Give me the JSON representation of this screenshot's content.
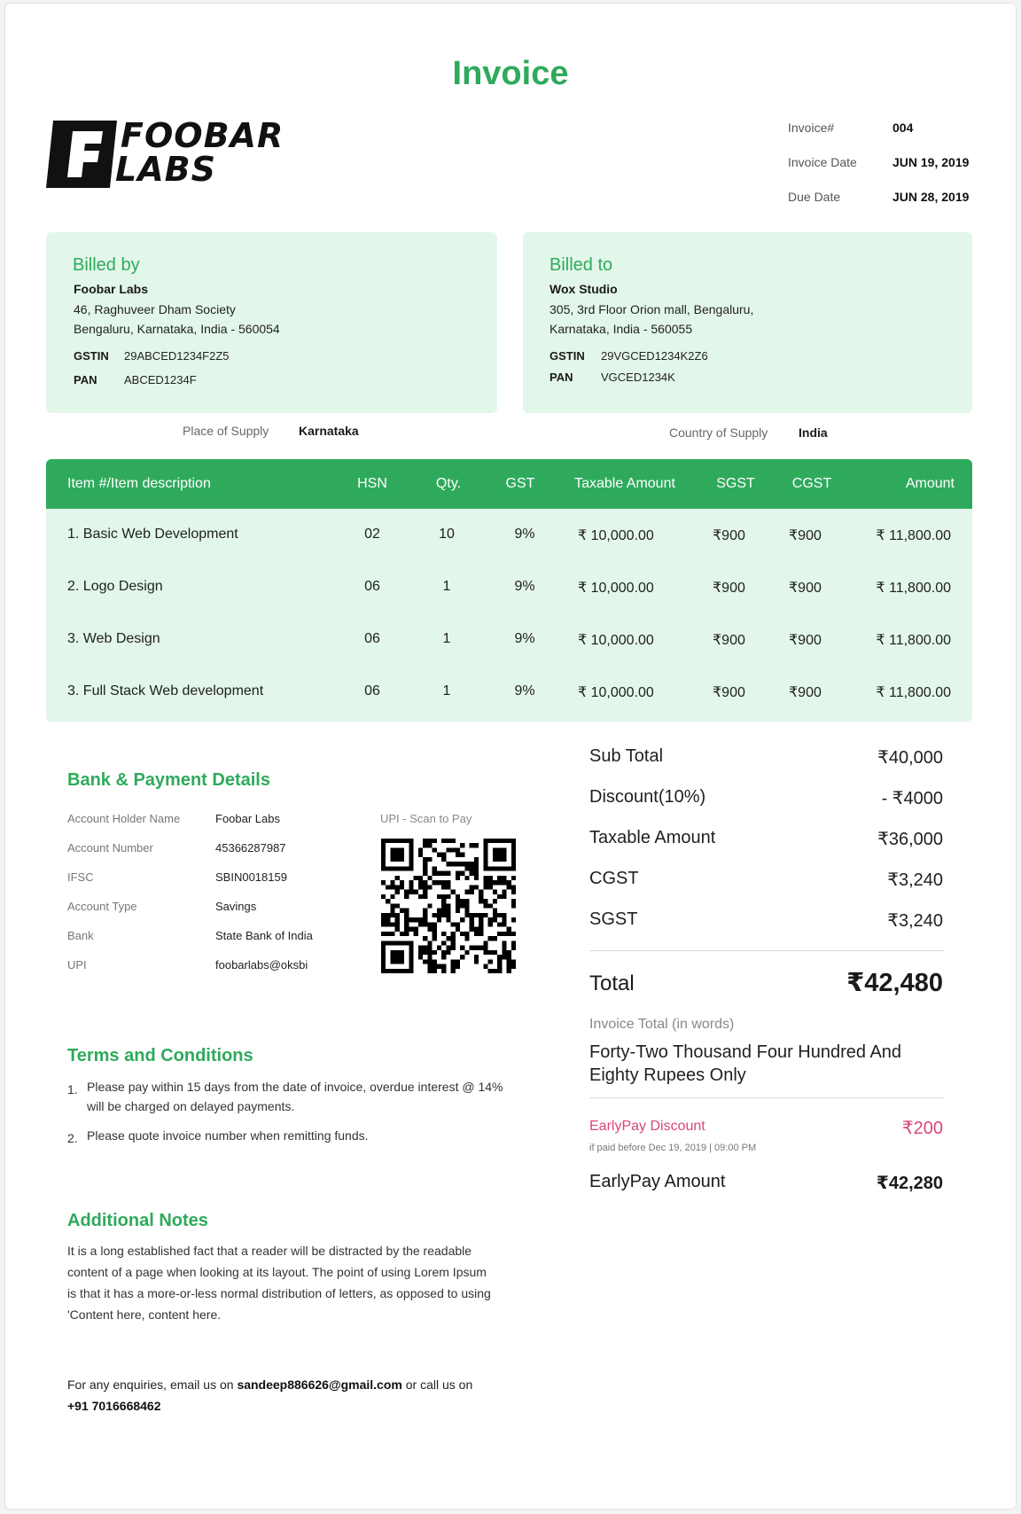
{
  "title": "Invoice",
  "logo": {
    "line1": "FOOBAR",
    "line2": "LABS",
    "mark": "F"
  },
  "meta": {
    "invoice_no_label": "Invoice#",
    "invoice_no": "004",
    "invoice_date_label": "Invoice Date",
    "invoice_date": "JUN 19, 2019",
    "due_date_label": "Due Date",
    "due_date": "JUN 28, 2019"
  },
  "billed_by": {
    "title": "Billed by",
    "name": "Foobar Labs",
    "address1": "46, Raghuveer Dham Society",
    "address2": "Bengaluru, Karnataka, India - 560054",
    "gstin_label": "GSTIN",
    "gstin": "29ABCED1234F2Z5",
    "pan_label": "PAN",
    "pan": "ABCED1234F"
  },
  "billed_to": {
    "title": "Billed to",
    "name": "Wox Studio",
    "address1": "305, 3rd Floor Orion mall, Bengaluru,",
    "address2": "Karnataka, India - 560055",
    "gstin_label": "GSTIN",
    "gstin": "29VGCED1234K2Z6",
    "pan_label": "PAN",
    "pan": "VGCED1234K"
  },
  "supply": {
    "place_label": "Place of Supply",
    "place": "Karnataka",
    "country_label": "Country of Supply",
    "country": "India"
  },
  "table": {
    "headers": [
      "Item #/Item description",
      "HSN",
      "Qty.",
      "GST",
      "Taxable Amount",
      "SGST",
      "CGST",
      "Amount"
    ],
    "rows": [
      {
        "item": "1.  Basic Web Development",
        "hsn": "02",
        "qty": "10",
        "gst": "9%",
        "taxable": "₹ 10,000.00",
        "sgst": "₹900",
        "cgst": "₹900",
        "amount": "₹ 11,800.00"
      },
      {
        "item": "2.  Logo Design",
        "hsn": "06",
        "qty": "1",
        "gst": "9%",
        "taxable": "₹ 10,000.00",
        "sgst": "₹900",
        "cgst": "₹900",
        "amount": "₹ 11,800.00"
      },
      {
        "item": "3.  Web Design",
        "hsn": "06",
        "qty": "1",
        "gst": "9%",
        "taxable": "₹ 10,000.00",
        "sgst": "₹900",
        "cgst": "₹900",
        "amount": "₹ 11,800.00"
      },
      {
        "item": "3.  Full Stack Web development",
        "hsn": "06",
        "qty": "1",
        "gst": "9%",
        "taxable": "₹ 10,000.00",
        "sgst": "₹900",
        "cgst": "₹900",
        "amount": "₹ 11,800.00"
      }
    ]
  },
  "bank": {
    "title": "Bank & Payment Details",
    "upi_caption": "UPI - Scan to Pay",
    "fields": [
      {
        "label": "Account Holder Name",
        "value": "Foobar Labs"
      },
      {
        "label": "Account Number",
        "value": "45366287987"
      },
      {
        "label": "IFSC",
        "value": "SBIN0018159"
      },
      {
        "label": "Account Type",
        "value": "Savings"
      },
      {
        "label": "Bank",
        "value": "State Bank of India"
      },
      {
        "label": "UPI",
        "value": "foobarlabs@oksbi"
      }
    ]
  },
  "summary": {
    "subtotal_label": "Sub Total",
    "subtotal": "₹40,000",
    "discount_label": "Discount(10%)",
    "discount": "- ₹4000",
    "taxable_label": "Taxable Amount",
    "taxable": "₹36,000",
    "cgst_label": "CGST",
    "cgst": "₹3,240",
    "sgst_label": "SGST",
    "sgst": "₹3,240",
    "total_label": "Total",
    "total": "₹42,480",
    "words_label": "Invoice Total (in words)",
    "words_line1": "Forty-Two Thousand Four Hundred And",
    "words_line2": "Eighty Rupees Only",
    "earlypay_label": "EarlyPay Discount",
    "earlypay": "₹200",
    "earlypay_note": "if paid before Dec 19, 2019 | 09:00 PM",
    "earlypay_amount_label": "EarlyPay Amount",
    "earlypay_amount": "₹42,280"
  },
  "terms": {
    "title": "Terms and Conditions",
    "items": [
      {
        "num": "1.",
        "line1": "Please pay within 15 days from the date of invoice, overdue interest @ 14%",
        "line2": "will be charged on delayed payments."
      },
      {
        "num": "2.",
        "line1": "Please quote invoice number when remitting funds.",
        "line2": ""
      }
    ]
  },
  "notes": {
    "title": "Additional Notes",
    "lines": [
      "It is a long established fact that a reader will be distracted by the readable",
      "content of a page when looking at its layout. The point of using Lorem Ipsum",
      "is that it has a more-or-less normal distribution of letters, as opposed to using",
      "'Content here, content here."
    ]
  },
  "footer": {
    "prefix": "For any enquiries, email us on ",
    "email": "sandeep886626@gmail.com",
    "middle": " or  call us on",
    "phone": "+91 7016668462"
  },
  "colors": {
    "accent": "#2faa5c",
    "panel": "#e3f6ea",
    "earlypay": "#d9467a"
  }
}
